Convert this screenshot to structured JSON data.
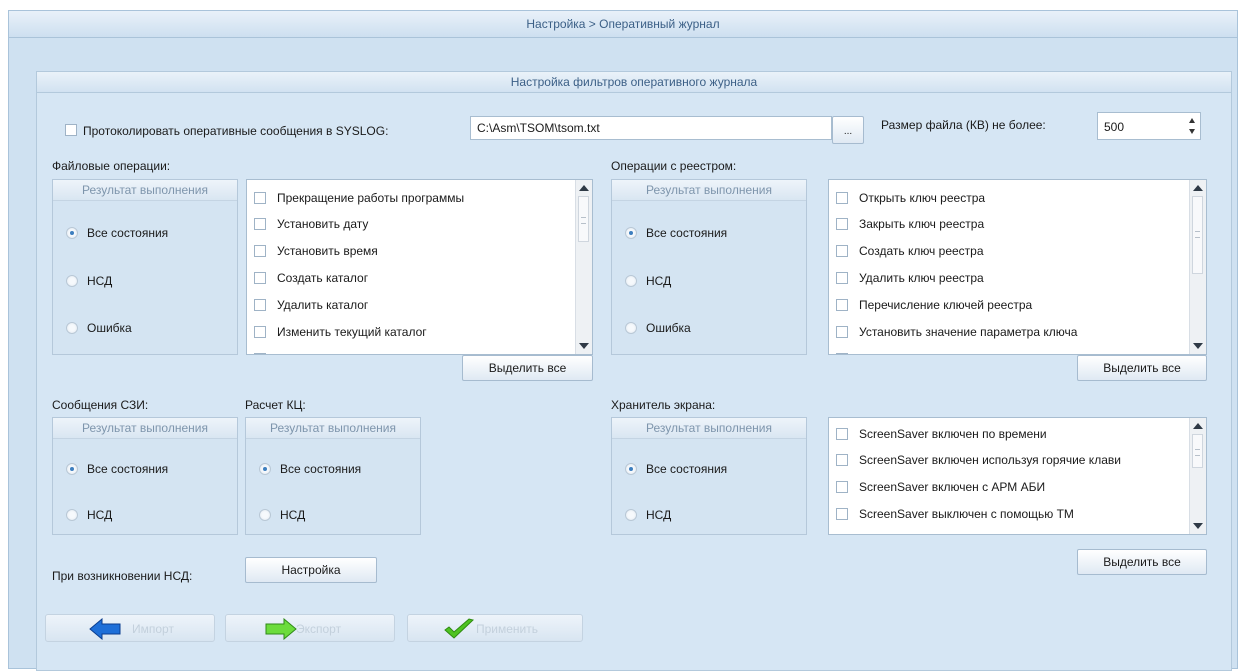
{
  "window": {
    "title": "Настройка > Оперативный журнал"
  },
  "panel": {
    "title": "Настройка фильтров оперативного журнала"
  },
  "syslog": {
    "checkbox_label": "Протоколировать оперативные сообщения в SYSLOG:",
    "path_value": "C:\\Asm\\TSOM\\tsom.txt",
    "browse_label": "...",
    "size_label": "Размер файла (КВ) не более:",
    "size_value": "500"
  },
  "file_ops": {
    "title": "Файловые операции:",
    "result": {
      "title": "Результат выполнения",
      "options": [
        "Все состояния",
        "НСД",
        "Ошибка"
      ],
      "selected": 0
    },
    "items": [
      "Прекращение работы программы",
      "Установить дату",
      "Установить время",
      "Создать каталог",
      "Удалить каталог",
      "Изменить текущий каталог"
    ],
    "select_all": "Выделить все"
  },
  "registry_ops": {
    "title": "Операции с реестром:",
    "result": {
      "title": "Результат выполнения",
      "options": [
        "Все состояния",
        "НСД",
        "Ошибка"
      ],
      "selected": 0
    },
    "items": [
      "Открыть ключ реестра",
      "Закрыть ключ реестра",
      "Создать ключ реестра",
      "Удалить ключ реестра",
      "Перечисление ключей реестра",
      "Установить значение параметра ключа"
    ],
    "select_all": "Выделить все"
  },
  "szi_messages": {
    "title": "Сообщения СЗИ:",
    "result": {
      "title": "Результат выполнения",
      "options": [
        "Все состояния",
        "НСД"
      ],
      "selected": 0
    }
  },
  "kc_calc": {
    "title": "Расчет КЦ:",
    "result": {
      "title": "Результат выполнения",
      "options": [
        "Все состояния",
        "НСД"
      ],
      "selected": 0
    }
  },
  "screensaver": {
    "title": "Хранитель экрана:",
    "result": {
      "title": "Результат выполнения",
      "options": [
        "Все состояния",
        "НСД"
      ],
      "selected": 0
    },
    "items": [
      "ScreenSaver включен по времени",
      "ScreenSaver включен используя горячие клави",
      "ScreenSaver включен с АРМ АБИ",
      "ScreenSaver выключен с помощью ТМ"
    ],
    "select_all": "Выделить все"
  },
  "nsd": {
    "label": "При возникновении НСД:",
    "button": "Настройка"
  },
  "footer": {
    "import_label": "Импорт",
    "export_label": "Экспорт",
    "apply_label": "Применить",
    "import_icon": "arrow-left-icon",
    "export_icon": "arrow-right-icon",
    "apply_icon": "checkmark-icon"
  },
  "colors": {
    "background": "#cfe1f1",
    "panel": "#d6e6f4",
    "accent": "#3e7fbf",
    "title_text": "#3b5f86"
  }
}
